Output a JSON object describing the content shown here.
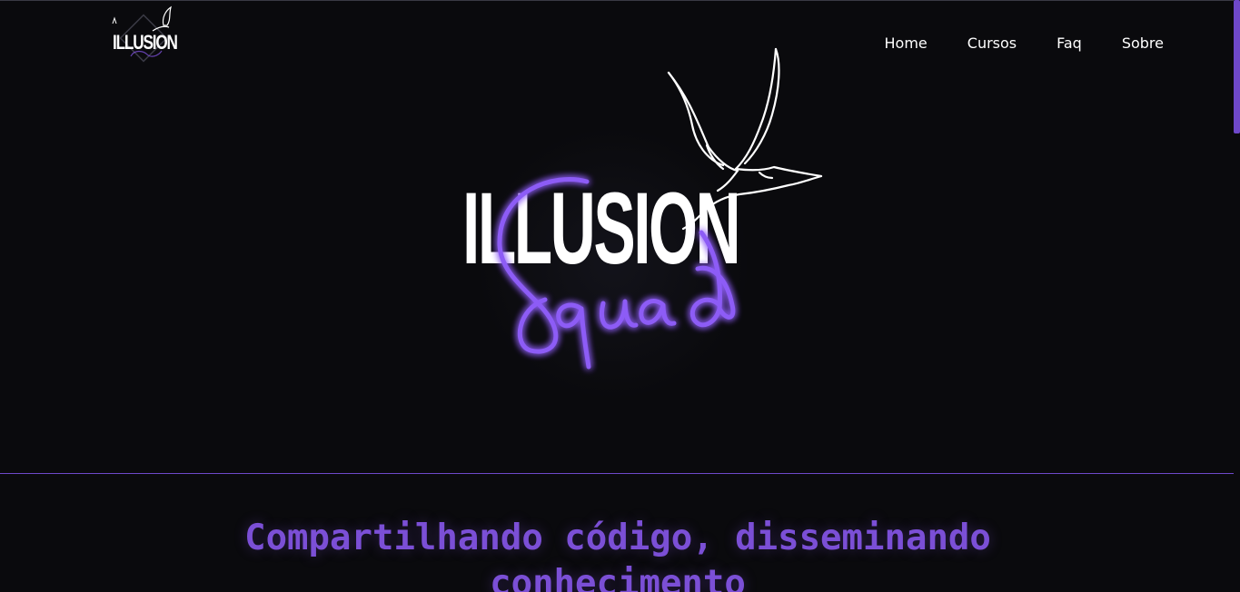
{
  "header": {
    "logo_text": "ILLUSION",
    "nav": [
      {
        "label": "Home"
      },
      {
        "label": "Cursos"
      },
      {
        "label": "Faq"
      },
      {
        "label": "Sobre"
      }
    ]
  },
  "hero": {
    "title": "ILLUSION",
    "script_word": "Squad"
  },
  "section": {
    "headline": "Compartilhando código, disseminando conhecimento"
  },
  "colors": {
    "background": "#0a0a0d",
    "accent": "#7b4fd6",
    "neon": "#8d5cf6",
    "text": "#ffffff"
  },
  "icons": {
    "dove": "dove-icon"
  }
}
